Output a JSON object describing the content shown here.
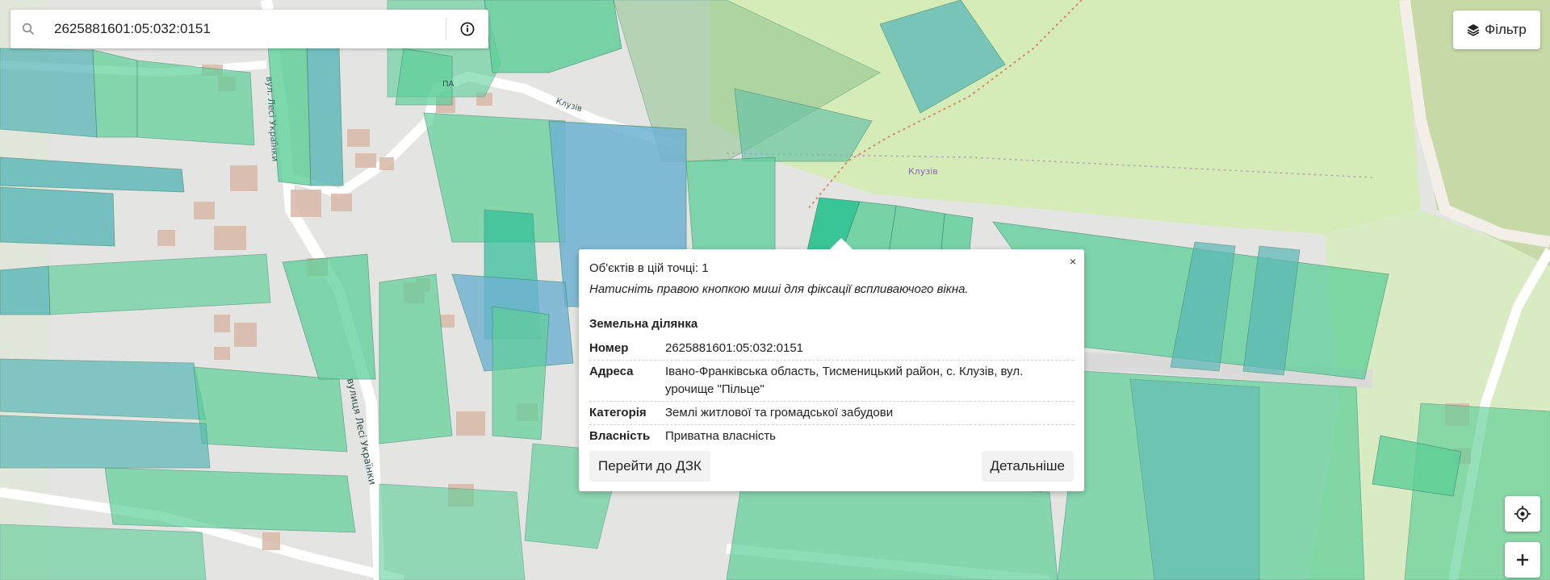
{
  "search": {
    "value": "2625881601:05:032:0151",
    "placeholder": ""
  },
  "filter": {
    "label": "Фільтр"
  },
  "map": {
    "labels": {
      "street_top": "вул. Лесі Українки",
      "street_main": "вулиця Лесі Українки",
      "street_fragment": "ПА",
      "village_road": "Клузів",
      "village": "Клузів"
    }
  },
  "popup": {
    "objects_count": "Об'єктів в цій точці: 1",
    "hint": "Натисніть правою кнопкою миші для фіксації вспливаючого вікна.",
    "close": "×",
    "section_title": "Земельна ділянка",
    "props": [
      {
        "key": "Номер",
        "value": "2625881601:05:032:0151"
      },
      {
        "key": "Адреса",
        "value": "Івано-Франківська область, Тисменицький район, с. Клузів, вул. урочище \"Пільце\""
      },
      {
        "key": "Категорія",
        "value": "Землі житлової та громадської забудови"
      },
      {
        "key": "Власність",
        "value": "Приватна власність"
      }
    ],
    "btn_dzk": "Перейти до ДЗК",
    "btn_details": "Детальніше"
  },
  "colors": {
    "parcel_green": "#5dcf98",
    "parcel_blue": "#6fb2d2",
    "parcel_selected": "#27c28d",
    "farmland": "#d6ecb8",
    "forest": "#c4d9a4",
    "road": "#ffffff",
    "building": "#d9b8a8"
  }
}
